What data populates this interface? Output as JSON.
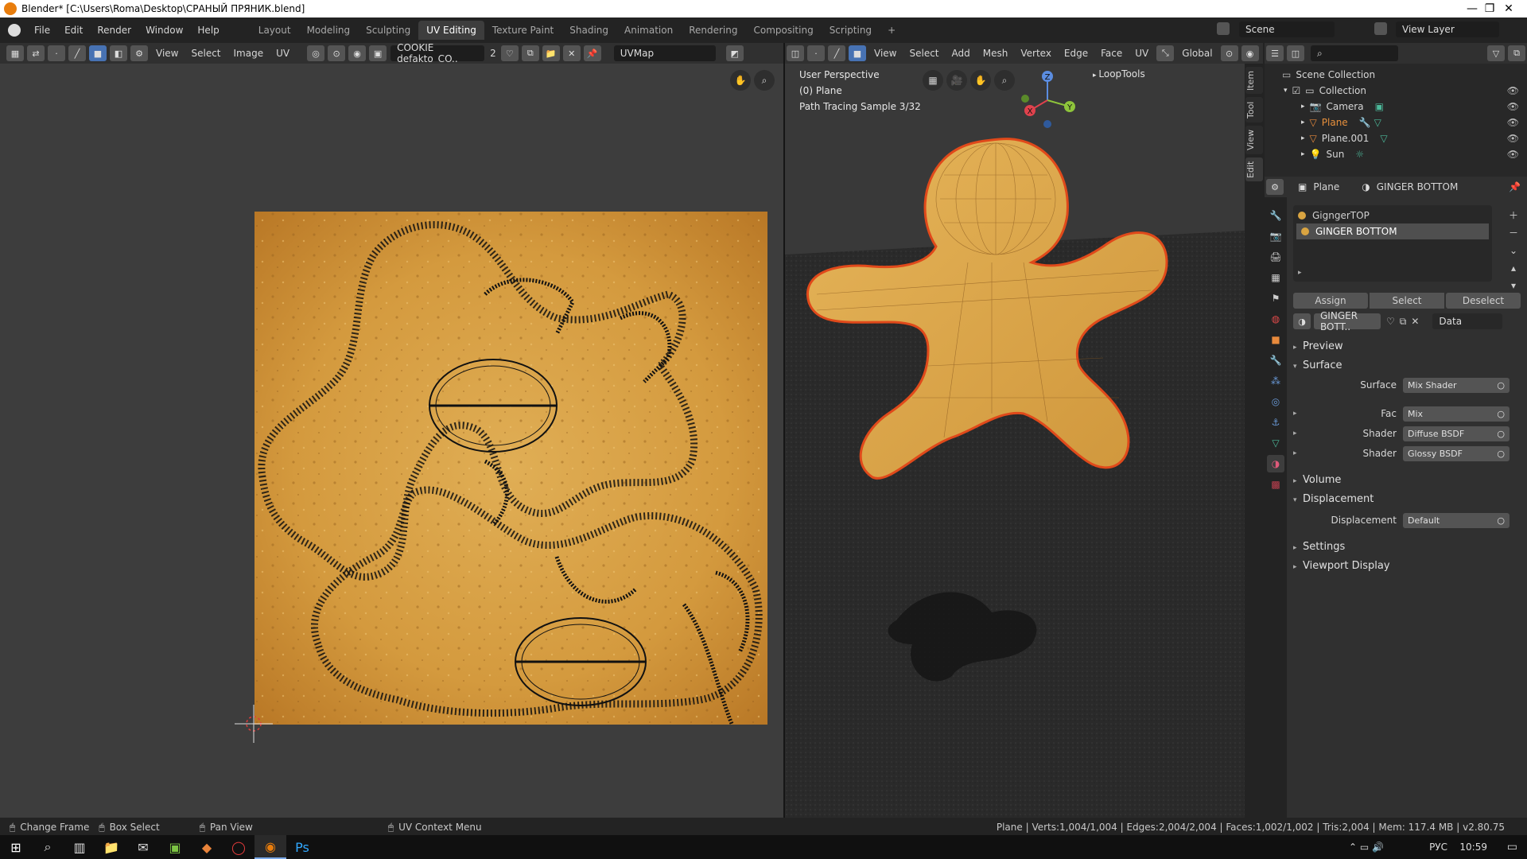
{
  "window": {
    "title": "Blender* [C:\\Users\\Roma\\Desktop\\СРАНЫЙ ПРЯНИК.blend]",
    "minimize": "—",
    "restore": "❐",
    "close": "✕"
  },
  "main_menu": [
    "File",
    "Edit",
    "Render",
    "Window",
    "Help"
  ],
  "workspaces": [
    "Layout",
    "Modeling",
    "Sculpting",
    "UV Editing",
    "Texture Paint",
    "Shading",
    "Animation",
    "Rendering",
    "Compositing",
    "Scripting"
  ],
  "workspace_add": "+",
  "scene": {
    "name": "Scene",
    "view_layer": "View Layer"
  },
  "uv_header": {
    "menus": [
      "View",
      "Select",
      "Image",
      "UV"
    ],
    "image_name": "COOKIE defakto_CO..",
    "users": "2",
    "uv_map": "UVMap"
  },
  "viewport_header": {
    "menus": [
      "View",
      "Select",
      "Add",
      "Mesh",
      "Vertex",
      "Edge",
      "Face",
      "UV"
    ],
    "orientation": "Global"
  },
  "viewport_overlay": {
    "perspective": "User Perspective",
    "object": "(0) Plane",
    "sample": "Path Tracing Sample 3/32",
    "looptools": "LoopTools",
    "axis_x": "X",
    "axis_y": "Y",
    "axis_z": "Z"
  },
  "sidebar_tabs": [
    "Item",
    "Tool",
    "View",
    "Edit"
  ],
  "outliner": {
    "root": "Scene Collection",
    "collection": "Collection",
    "items": [
      "Camera",
      "Plane",
      "Plane.001",
      "Sun"
    ]
  },
  "properties": {
    "object": "Plane",
    "material": "GINGER BOTTOM",
    "slots": [
      "GigngerTOP",
      "GINGER BOTTOM"
    ],
    "buttons": [
      "Assign",
      "Select",
      "Deselect"
    ],
    "material_field": "GINGER BOTT..",
    "link": "Data",
    "panels": {
      "preview": "Preview",
      "surface": "Surface",
      "volume": "Volume",
      "displacement": "Displacement",
      "settings": "Settings",
      "viewport_display": "Viewport Display"
    },
    "rows": {
      "surface_label": "Surface",
      "surface_value": "Mix Shader",
      "fac_label": "Fac",
      "fac_value": "Mix",
      "shader1_label": "Shader",
      "shader1_value": "Diffuse BSDF",
      "shader2_label": "Shader",
      "shader2_value": "Glossy BSDF",
      "disp_label": "Displacement",
      "disp_value": "Default"
    }
  },
  "statusbar": {
    "change_frame": "Change Frame",
    "box_select": "Box Select",
    "pan_view": "Pan View",
    "context_menu": "UV Context Menu",
    "stats": "Plane | Verts:1,004/1,004 | Edges:2,004/2,004 | Faces:1,002/1,002 | Tris:2,004 | Mem: 117.4 MB | v2.80.75"
  },
  "taskbar": {
    "lang": "РУС",
    "time": "10:59"
  },
  "colors": {
    "accent": "#4772b3",
    "orange": "#e87d0d",
    "cookie": "#d9a441",
    "selection_outline": "#e0491a"
  }
}
